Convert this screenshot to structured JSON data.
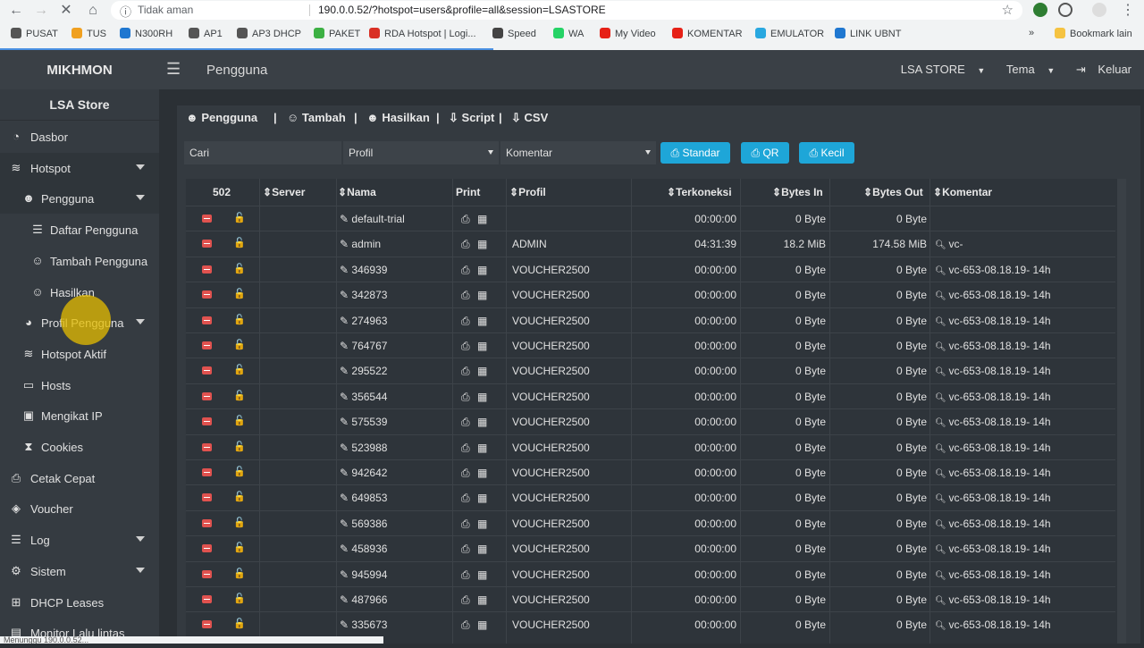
{
  "browser": {
    "insecure_label": "Tidak aman",
    "url": "190.0.0.52/?hotspot=users&profile=all&session=LSASTORE",
    "bookmarks": [
      {
        "label": "PUSAT",
        "color": "#555555"
      },
      {
        "label": "TUS",
        "color": "#f0a020"
      },
      {
        "label": "N300RH",
        "color": "#1f77d0"
      },
      {
        "label": "AP1",
        "color": "#555555"
      },
      {
        "label": "AP3 DHCP",
        "color": "#555555"
      },
      {
        "label": "PAKET",
        "color": "#3cb043"
      },
      {
        "label": "RDA Hotspot | Logi...",
        "color": "#d93025"
      },
      {
        "label": "Speed",
        "color": "#444444"
      },
      {
        "label": "WA",
        "color": "#25d366"
      },
      {
        "label": "My Video",
        "color": "#e62117"
      },
      {
        "label": "KOMENTAR",
        "color": "#e62117"
      },
      {
        "label": "EMULATOR",
        "color": "#29a8e0"
      },
      {
        "label": "LINK UBNT",
        "color": "#1f77d0"
      }
    ],
    "other_bookmarks": "Bookmark lain",
    "status": "Menunggu 190.0.0.52..."
  },
  "topbar": {
    "brand": "MIKHMON",
    "title": "Pengguna",
    "session": "LSA STORE",
    "theme": "Tema",
    "logout": "Keluar"
  },
  "sidebar": {
    "title": "LSA Store",
    "items": [
      {
        "label": "Dasbor",
        "icon": "dashboard-icon",
        "glyph": "◔",
        "indent": 0,
        "caret": false
      },
      {
        "label": "Hotspot",
        "icon": "wifi-icon",
        "glyph": "≋",
        "indent": 0,
        "caret": true
      },
      {
        "label": "Pengguna",
        "icon": "users-icon",
        "glyph": "☻",
        "indent": 1,
        "caret": true
      },
      {
        "label": "Daftar Pengguna",
        "icon": "list-icon",
        "glyph": "☰",
        "indent": 2,
        "caret": false
      },
      {
        "label": "Tambah Pengguna",
        "icon": "user-plus-icon",
        "glyph": "☺",
        "indent": 2,
        "caret": false
      },
      {
        "label": "Hasilkan",
        "icon": "user-plus-icon",
        "glyph": "☺",
        "indent": 2,
        "caret": false
      },
      {
        "label": "Profil Pengguna",
        "icon": "pie-chart-icon",
        "glyph": "◕",
        "indent": 1,
        "caret": true
      },
      {
        "label": "Hotspot Aktif",
        "icon": "wifi-icon",
        "glyph": "≋",
        "indent": 1,
        "caret": false
      },
      {
        "label": "Hosts",
        "icon": "laptop-icon",
        "glyph": "▭",
        "indent": 1,
        "caret": false
      },
      {
        "label": "Mengikat IP",
        "icon": "address-card-icon",
        "glyph": "▣",
        "indent": 1,
        "caret": false
      },
      {
        "label": "Cookies",
        "icon": "hourglass-icon",
        "glyph": "⧗",
        "indent": 1,
        "caret": false
      },
      {
        "label": "Cetak Cepat",
        "icon": "print-icon",
        "glyph": "⎙",
        "indent": 0,
        "caret": false
      },
      {
        "label": "Voucher",
        "icon": "ticket-icon",
        "glyph": "◈",
        "indent": 0,
        "caret": false
      },
      {
        "label": "Log",
        "icon": "log-icon",
        "glyph": "☰",
        "indent": 0,
        "caret": true
      },
      {
        "label": "Sistem",
        "icon": "gear-icon",
        "glyph": "⚙",
        "indent": 0,
        "caret": true
      },
      {
        "label": "DHCP Leases",
        "icon": "sitemap-icon",
        "glyph": "⊞",
        "indent": 0,
        "caret": false
      },
      {
        "label": "Monitor Lalu lintas",
        "icon": "chart-icon",
        "glyph": "▤",
        "indent": 0,
        "caret": false
      }
    ]
  },
  "card": {
    "header": {
      "title": "Pengguna",
      "add": "Tambah",
      "generate": "Hasilkan",
      "script": "Script",
      "csv": "CSV"
    },
    "filters": {
      "search_placeholder": "Cari",
      "profile": "Profil",
      "comment": "Komentar"
    },
    "buttons": {
      "standard": "Standar",
      "qr": "QR",
      "small": "Kecil"
    }
  },
  "table": {
    "count": "502",
    "headers": {
      "server": "Server",
      "name": "Nama",
      "print": "Print",
      "profile": "Profil",
      "uptime": "Terkoneksi",
      "bytes_in": "Bytes In",
      "bytes_out": "Bytes Out",
      "comment": "Komentar"
    },
    "rows": [
      {
        "name": "default-trial",
        "profile": "",
        "uptime": "00:00:00",
        "bytes_in": "0 Byte",
        "bytes_out": "0 Byte",
        "comment": ""
      },
      {
        "name": "admin",
        "profile": "ADMIN",
        "uptime": "04:31:39",
        "bytes_in": "18.2 MiB",
        "bytes_out": "174.58 MiB",
        "comment": "vc-"
      },
      {
        "name": "346939",
        "profile": "VOUCHER2500",
        "uptime": "00:00:00",
        "bytes_in": "0 Byte",
        "bytes_out": "0 Byte",
        "comment": "vc-653-08.18.19- 14h"
      },
      {
        "name": "342873",
        "profile": "VOUCHER2500",
        "uptime": "00:00:00",
        "bytes_in": "0 Byte",
        "bytes_out": "0 Byte",
        "comment": "vc-653-08.18.19- 14h"
      },
      {
        "name": "274963",
        "profile": "VOUCHER2500",
        "uptime": "00:00:00",
        "bytes_in": "0 Byte",
        "bytes_out": "0 Byte",
        "comment": "vc-653-08.18.19- 14h"
      },
      {
        "name": "764767",
        "profile": "VOUCHER2500",
        "uptime": "00:00:00",
        "bytes_in": "0 Byte",
        "bytes_out": "0 Byte",
        "comment": "vc-653-08.18.19- 14h"
      },
      {
        "name": "295522",
        "profile": "VOUCHER2500",
        "uptime": "00:00:00",
        "bytes_in": "0 Byte",
        "bytes_out": "0 Byte",
        "comment": "vc-653-08.18.19- 14h"
      },
      {
        "name": "356544",
        "profile": "VOUCHER2500",
        "uptime": "00:00:00",
        "bytes_in": "0 Byte",
        "bytes_out": "0 Byte",
        "comment": "vc-653-08.18.19- 14h"
      },
      {
        "name": "575539",
        "profile": "VOUCHER2500",
        "uptime": "00:00:00",
        "bytes_in": "0 Byte",
        "bytes_out": "0 Byte",
        "comment": "vc-653-08.18.19- 14h"
      },
      {
        "name": "523988",
        "profile": "VOUCHER2500",
        "uptime": "00:00:00",
        "bytes_in": "0 Byte",
        "bytes_out": "0 Byte",
        "comment": "vc-653-08.18.19- 14h"
      },
      {
        "name": "942642",
        "profile": "VOUCHER2500",
        "uptime": "00:00:00",
        "bytes_in": "0 Byte",
        "bytes_out": "0 Byte",
        "comment": "vc-653-08.18.19- 14h"
      },
      {
        "name": "649853",
        "profile": "VOUCHER2500",
        "uptime": "00:00:00",
        "bytes_in": "0 Byte",
        "bytes_out": "0 Byte",
        "comment": "vc-653-08.18.19- 14h"
      },
      {
        "name": "569386",
        "profile": "VOUCHER2500",
        "uptime": "00:00:00",
        "bytes_in": "0 Byte",
        "bytes_out": "0 Byte",
        "comment": "vc-653-08.18.19- 14h"
      },
      {
        "name": "458936",
        "profile": "VOUCHER2500",
        "uptime": "00:00:00",
        "bytes_in": "0 Byte",
        "bytes_out": "0 Byte",
        "comment": "vc-653-08.18.19- 14h"
      },
      {
        "name": "945994",
        "profile": "VOUCHER2500",
        "uptime": "00:00:00",
        "bytes_in": "0 Byte",
        "bytes_out": "0 Byte",
        "comment": "vc-653-08.18.19- 14h"
      },
      {
        "name": "487966",
        "profile": "VOUCHER2500",
        "uptime": "00:00:00",
        "bytes_in": "0 Byte",
        "bytes_out": "0 Byte",
        "comment": "vc-653-08.18.19- 14h"
      },
      {
        "name": "335673",
        "profile": "VOUCHER2500",
        "uptime": "00:00:00",
        "bytes_in": "0 Byte",
        "bytes_out": "0 Byte",
        "comment": "vc-653-08.18.19- 14h"
      }
    ]
  }
}
